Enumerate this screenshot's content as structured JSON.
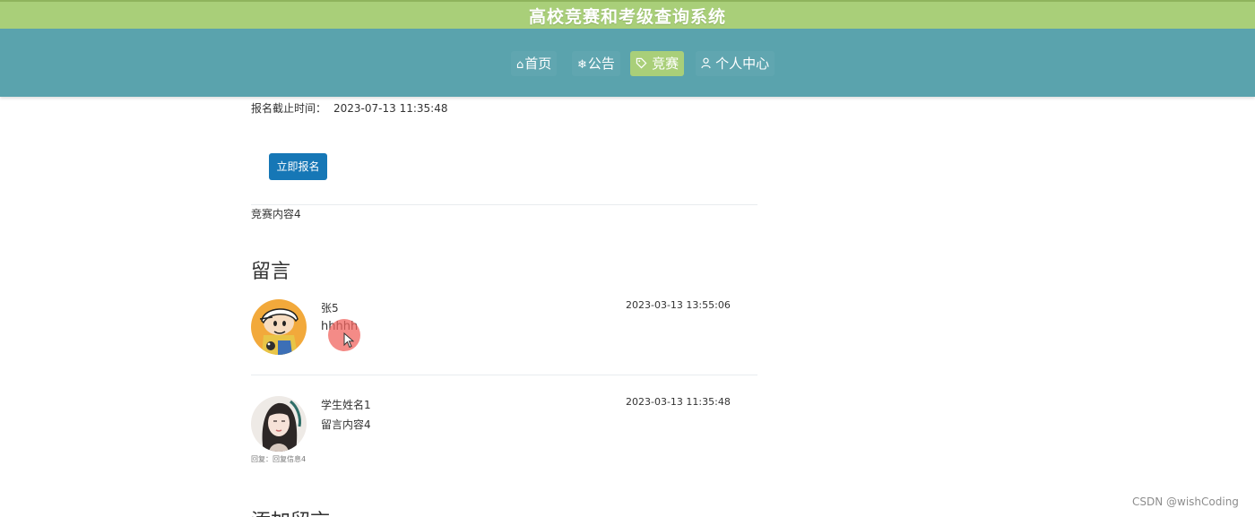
{
  "header": {
    "site_title": "高校竞赛和考级查询系统"
  },
  "nav": {
    "items": [
      {
        "icon": "home-icon",
        "glyph": "⌂",
        "label": "首页",
        "active": false
      },
      {
        "icon": "snowflake-icon",
        "glyph": "❄",
        "label": "公告",
        "active": false
      },
      {
        "icon": "tag-icon",
        "glyph": "",
        "label": "竞赛",
        "active": true
      },
      {
        "icon": "user-icon",
        "glyph": "",
        "label": "个人中心",
        "active": false
      }
    ]
  },
  "competition": {
    "deadline_label": "报名截止时间：",
    "deadline_value": "2023-07-13 11:35:48",
    "signup_button": "立即报名",
    "content": "竞赛内容4"
  },
  "comments": {
    "section_title": "留言",
    "items": [
      {
        "author": "张5",
        "text": "hhhhh",
        "time": "2023-03-13 13:55:06",
        "avatar": "cartoon-boy-avatar"
      },
      {
        "author": "学生姓名1",
        "text": "留言内容4",
        "time": "2023-03-13 11:35:48",
        "avatar": "girl-avatar",
        "reply": "回复：回复信息4"
      }
    ]
  },
  "add_comment": {
    "title": "添加留言"
  },
  "watermark": "CSDN @wishCoding",
  "colors": {
    "title_bar": "#a9cf79",
    "nav_bar": "#5aa3ad",
    "nav_active": "#a9cf79",
    "primary_button": "#1677b6"
  }
}
